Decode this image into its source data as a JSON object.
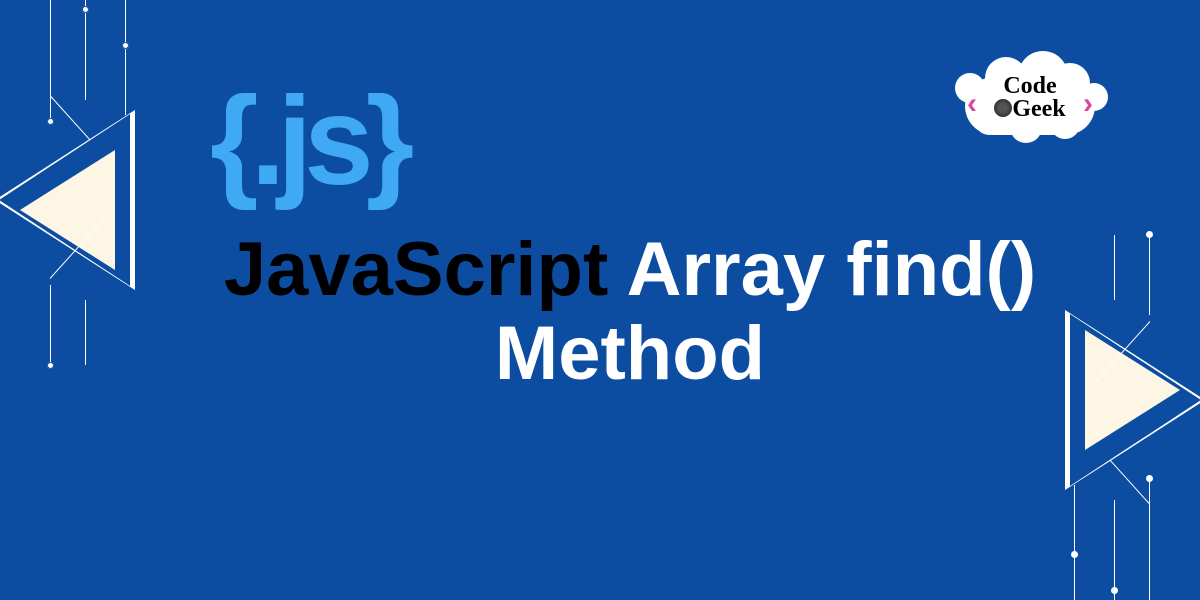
{
  "logo": {
    "js_symbol": "{.js}"
  },
  "heading": {
    "javascript": "JavaScript",
    "array_find": " Array find()",
    "method": "Method"
  },
  "cloud_logo": {
    "bracket_left": "‹",
    "bracket_right": "›",
    "word_top": "Code",
    "word_bottom": "Geek",
    "alt": "CodeForGeek logo"
  },
  "colors": {
    "background": "#0c4da2",
    "js_logo": "#3fa9f5",
    "accent_cream": "#fef6e4",
    "bracket_pink": "#d946a0"
  }
}
